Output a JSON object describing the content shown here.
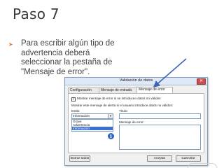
{
  "slide": {
    "title": "Paso 7",
    "bullet_symbol": "➤",
    "bullet_text": "Para escribir algún tipo de advertencia deberá seleccionar la pestaña de \"Mensaje de error\"."
  },
  "dialog": {
    "title": "Validación de datos",
    "close_glyph": "✕",
    "tabs": [
      {
        "label": "Configuración",
        "active": false
      },
      {
        "label": "Mensaje de entrada",
        "active": false
      },
      {
        "label": "Mensaje de error",
        "active": true
      }
    ],
    "show_error_checkbox": {
      "checked": true,
      "label": "Mostrar mensaje de error si se introducen datos no válidos"
    },
    "section_caption": "Mostrar este mensaje de alerta si el usuario introduce datos no válidos:",
    "style_label": "Estilo:",
    "style_value": "Información",
    "style_options": [
      "Grave",
      "Advertencia",
      "Información"
    ],
    "selected_option": "Información",
    "title_label": "Título:",
    "title_value": "",
    "error_message_label": "Mensaje de error:",
    "error_message_value": "",
    "info_icon_glyph": "i",
    "buttons": {
      "clear_all": "Borrar todos",
      "accept": "Aceptar",
      "cancel": "Cancelar"
    }
  },
  "colors": {
    "accent_orange": "#e07b3a",
    "arrow_blue": "#3f62b5"
  }
}
